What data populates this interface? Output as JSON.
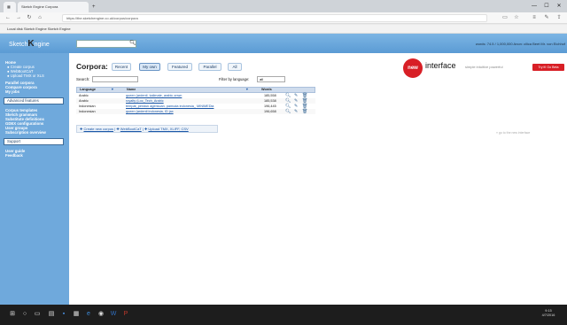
{
  "browser": {
    "tabs": [
      {
        "label": "Sketch Engine Corpora"
      }
    ],
    "new_tab": "+",
    "url": "https://the.sketchengine.co.uk/corpus/corpora",
    "bookmarks": "Local disk   Sketch Engine   Sketch Engine",
    "window_controls": {
      "minimize": "—",
      "maximize": "☐",
      "close": "✕"
    }
  },
  "header": {
    "logo_pre": "Sketch",
    "logo_k": "K",
    "logo_post": "ngine",
    "user_info": "words: 74.5 / 1,000,000   Anon: cilica Beet   Mr. von Eichhof"
  },
  "sidebar": {
    "home": "Home",
    "home_items": [
      "● Create corpus",
      "● WebBootCaT",
      "● Upload TMX or XLS"
    ],
    "items1": [
      "Parallel corpora",
      "Compare corpora",
      "My jobs"
    ],
    "advanced": "Advanced features",
    "items2": [
      "Corpus templates",
      "Sketch grammars",
      "Substitute definitions",
      "GDEX configurations",
      "User groups",
      "Subscription overview"
    ],
    "support": "Support",
    "items3": [
      "User guide",
      "Feedback"
    ]
  },
  "main": {
    "title": "Corpora:",
    "tabs": [
      "Recent",
      "My own",
      "Featured",
      "Parallel",
      "All"
    ],
    "active_tab": "My own",
    "search_label": "Search:",
    "filter_label": "Filter by language:",
    "filter_value": "all",
    "table": {
      "headers": [
        "Language",
        "Name",
        "Words"
      ],
      "rows": [
        {
          "language": "Arabic",
          "name": "queen (ardenti, kalimate, arabic onwn",
          "words": "185,558"
        },
        {
          "language": "Arabic",
          "name": "royalty (Loc_Tech_Arabic",
          "words": "185,538"
        },
        {
          "language": "Indonesian",
          "name": "tempat_penduk agenscan, pamuda indonesia_ MINIMEDia",
          "words": "196,445"
        },
        {
          "language": "Indonesian",
          "name": "queen (ardenti indonesia, ID jax",
          "words": "196,658"
        }
      ]
    },
    "footer_links": [
      "Create new corpus",
      "WebBootCaT",
      "Upload TMX, XLIFF, CSV"
    ]
  },
  "promo": {
    "badge": "new",
    "title": "interface",
    "subtitle": "simple   intuitive   powerful",
    "button": "Try it! Go Beta"
  },
  "side_note": "» go to the new interface",
  "clock": {
    "time": "9:15",
    "date": "4/7/2016"
  },
  "colors": {
    "header": "#6fa9dc",
    "accent": "#d81f26",
    "link": "#1a57a8"
  }
}
